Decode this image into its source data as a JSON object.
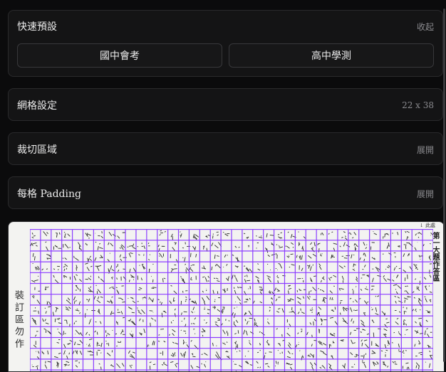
{
  "quick_presets": {
    "title": "快速預設",
    "action": "收起",
    "buttons": [
      "國中會考",
      "高中學測"
    ]
  },
  "grid_settings": {
    "title": "網格設定",
    "value": "22 x 38"
  },
  "crop_area": {
    "title": "裁切區域",
    "action": "展開"
  },
  "padding": {
    "title": "每格 Padding",
    "action": "展開"
  },
  "preview": {
    "binding_label": "裝訂區勿作",
    "answer_area_label": "第一大題作答區",
    "corner_note": "↓ 此處",
    "grid_color": "#8b3dff"
  }
}
